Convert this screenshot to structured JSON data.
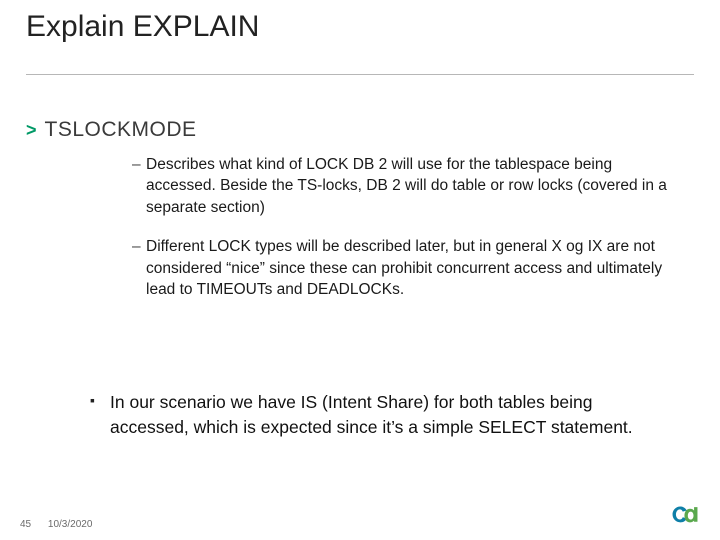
{
  "title": "Explain EXPLAIN",
  "subhead": {
    "marker": ">",
    "text": "TSLOCKMODE"
  },
  "bullets": [
    {
      "marker": "–",
      "text": "Describes what kind of LOCK DB 2 will use for the tablespace being accessed. Beside the TS-locks, DB 2 will do table or row locks (covered in a separate section)"
    },
    {
      "marker": "–",
      "text": "Different LOCK types will be described later, but in general X og IX are not considered “nice” since these can prohibit concurrent access and ultimately lead to TIMEOUTs and DEADLOCKs."
    }
  ],
  "scenario": {
    "marker": "▪",
    "text": "In our scenario we have IS (Intent Share) for both tables being accessed, which is expected since it’s a simple SELECT statement."
  },
  "footer": {
    "page": "45",
    "date": "10/3/2020"
  },
  "logo": {
    "name": "ca-logo"
  }
}
